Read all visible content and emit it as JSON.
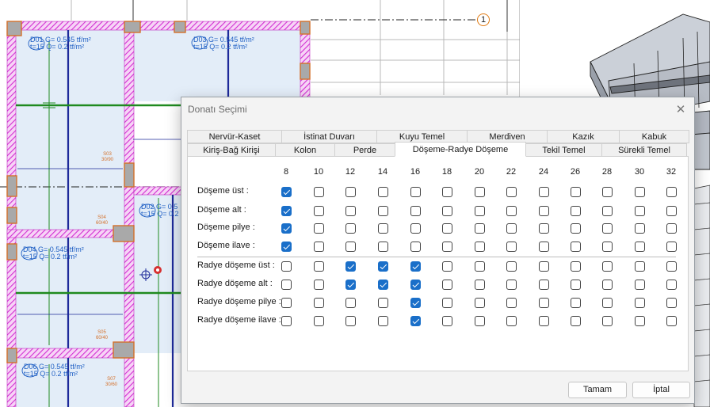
{
  "drawing": {
    "axis_label": "1",
    "slab_labels": [
      {
        "name": "D01",
        "thickness": "t=15",
        "g": "G= 0.545 tf/m²",
        "q": "Q= 0.2 tf/m²"
      },
      {
        "name": "D03",
        "thickness": "t=15",
        "g": "G= 0.545 tf/m²",
        "q": "Q= 0.2 tf/m²"
      },
      {
        "name": "D02",
        "thickness": "t=15",
        "g": "G= 0.5",
        "q": "Q= 0.2"
      },
      {
        "name": "D04",
        "thickness": "t=15",
        "g": "G= 0.545 tf/m²",
        "q": "Q= 0.2 tf/m²"
      },
      {
        "name": "D06",
        "thickness": "t=15",
        "g": "G= 0.545 tf/m²",
        "q": "Q= 0.2 tf/m²"
      }
    ],
    "beam_labels": [
      {
        "name": "S03",
        "size": "30/90"
      },
      {
        "name": "S04",
        "size": "60/40"
      },
      {
        "name": "S05",
        "size": "60/40"
      },
      {
        "name": "S07",
        "size": "30/60"
      }
    ]
  },
  "dialog": {
    "title": "Donatı Seçimi",
    "close_icon": "close-icon",
    "tabs_top": [
      "Nervür-Kaset",
      "İstinat Duvarı",
      "Kuyu Temel",
      "Merdiven",
      "Kazık",
      "Kabuk"
    ],
    "tabs_bottom": [
      "Kiriş-Bağ Kirişi",
      "Kolon",
      "Perde",
      "Döşeme-Radye Döşeme",
      "Tekil Temel",
      "Sürekli Temel"
    ],
    "active_tab": "Döşeme-Radye Döşeme",
    "diameters": [
      "8",
      "10",
      "12",
      "14",
      "16",
      "18",
      "20",
      "22",
      "24",
      "26",
      "28",
      "30",
      "32"
    ],
    "rows": [
      {
        "label": "Döşeme üst :",
        "checked": [
          true,
          false,
          false,
          false,
          false,
          false,
          false,
          false,
          false,
          false,
          false,
          false,
          false
        ]
      },
      {
        "label": "Döşeme alt :",
        "checked": [
          true,
          false,
          false,
          false,
          false,
          false,
          false,
          false,
          false,
          false,
          false,
          false,
          false
        ]
      },
      {
        "label": "Döşeme pilye :",
        "checked": [
          true,
          false,
          false,
          false,
          false,
          false,
          false,
          false,
          false,
          false,
          false,
          false,
          false
        ]
      },
      {
        "label": "Döşeme ilave :",
        "checked": [
          true,
          false,
          false,
          false,
          false,
          false,
          false,
          false,
          false,
          false,
          false,
          false,
          false
        ]
      },
      {
        "label": "Radye döşeme üst :",
        "checked": [
          false,
          false,
          true,
          true,
          true,
          false,
          false,
          false,
          false,
          false,
          false,
          false,
          false
        ]
      },
      {
        "label": "Radye döşeme alt :",
        "checked": [
          false,
          false,
          true,
          true,
          true,
          false,
          false,
          false,
          false,
          false,
          false,
          false,
          false
        ]
      },
      {
        "label": "Radye döşeme pilye :",
        "checked": [
          false,
          false,
          false,
          false,
          true,
          false,
          false,
          false,
          false,
          false,
          false,
          false,
          false
        ]
      },
      {
        "label": "Radye döşeme ilave :",
        "checked": [
          false,
          false,
          false,
          false,
          true,
          false,
          false,
          false,
          false,
          false,
          false,
          false,
          false
        ]
      }
    ],
    "ok_label": "Tamam",
    "cancel_label": "İptal"
  },
  "colors": {
    "checkbox_accent": "#1a6fc9",
    "wall_hatch": "#d22fd2",
    "beam_blue": "#1e2a9a",
    "rebar_green": "#1f8a1f",
    "column_orange": "#d4702a"
  }
}
